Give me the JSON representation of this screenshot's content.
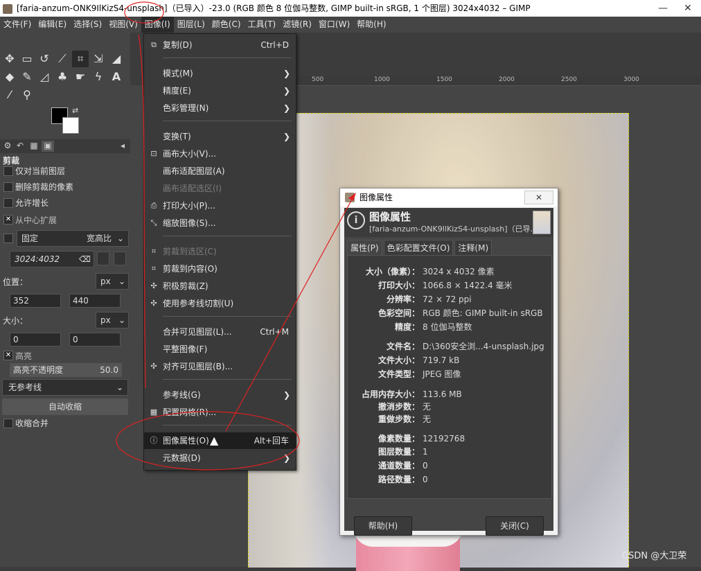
{
  "window": {
    "title": "[faria-anzum-ONK9IlKizS4-unsplash]（已导入）-23.0 (RGB 颜色 8 位伽马整数, GIMP built-in sRGB, 1 个图层) 3024x4032 – GIMP",
    "minimize": "—",
    "close": "✕"
  },
  "menubar": [
    "文件(F)",
    "编辑(E)",
    "选择(S)",
    "视图(V)",
    "图像(I)",
    "图层(L)",
    "颜色(C)",
    "工具(T)",
    "滤镜(R)",
    "窗口(W)",
    "帮助(H)"
  ],
  "toolbox": {
    "section_title": "剪裁",
    "opt_current_layer": "仅对当前图层",
    "opt_delete_pixels": "删除剪裁的像素",
    "opt_allow_grow": "允许增长",
    "opt_expand_center": "从中心扩展",
    "fixed_label": "固定",
    "fixed_value": "宽高比",
    "ratio_value": "3024:4032",
    "position_label": "位置：",
    "position_unit": "px",
    "pos_x": "352",
    "pos_y": "440",
    "size_label": "大小：",
    "size_unit": "px",
    "size_w": "0",
    "size_h": "0",
    "highlight_label": "高亮",
    "highlight_opacity_label": "高亮不透明度",
    "highlight_opacity_value": "50.0",
    "guides_value": "无参考线",
    "auto_shrink": "自动收缩",
    "shrink_merged": "收缩合并"
  },
  "ruler": [
    "500",
    "1000",
    "1500",
    "2000",
    "2500",
    "3000"
  ],
  "image_menu": {
    "items": [
      {
        "label": "复制(D)",
        "shortcut": "Ctrl+D",
        "icon": "duplicate-icon"
      },
      {
        "label": "模式(M)",
        "submenu": true
      },
      {
        "label": "精度(E)",
        "submenu": true
      },
      {
        "label": "色彩管理(N)",
        "submenu": true
      },
      {
        "label": "变换(T)",
        "submenu": true
      },
      {
        "label": "画布大小(V)...",
        "icon": "canvas-size-icon"
      },
      {
        "label": "画布适配图层(A)"
      },
      {
        "label": "画布适配选区(I)",
        "disabled": true
      },
      {
        "label": "打印大小(P)...",
        "icon": "print-size-icon"
      },
      {
        "label": "缩放图像(S)...",
        "icon": "scale-image-icon"
      },
      {
        "label": "剪裁到选区(C)",
        "disabled": true,
        "icon": "crop-selection-icon"
      },
      {
        "label": "剪裁到内容(O)",
        "icon": "crop-content-icon"
      },
      {
        "label": "积极剪裁(Z)",
        "icon": "zealous-crop-icon"
      },
      {
        "label": "使用参考线切割(U)",
        "icon": "guillotine-icon"
      },
      {
        "label": "合并可见图层(L)...",
        "shortcut": "Ctrl+M"
      },
      {
        "label": "平整图像(F)"
      },
      {
        "label": "对齐可见图层(B)...",
        "icon": "align-layers-icon"
      },
      {
        "label": "参考线(G)",
        "submenu": true
      },
      {
        "label": "配置网格(R)...",
        "icon": "grid-icon"
      },
      {
        "label": "图像属性(O)",
        "shortcut": "Alt+回车",
        "icon": "info-icon",
        "highlighted": true
      },
      {
        "label": "元数据(D)",
        "submenu": true
      }
    ]
  },
  "dialog": {
    "title": "图像属性",
    "close": "✕",
    "header_title": "图像属性",
    "header_sub": "[faria-anzum-ONK9IlKizS4-unsplash]（已导...",
    "tabs": [
      "属性(P)",
      "色彩配置文件(O)",
      "注释(M)"
    ],
    "rows": [
      {
        "k": "大小（像素）：",
        "v": "3024 x 4032 像素"
      },
      {
        "k": "打印大小：",
        "v": "1066.8 × 1422.4 毫米"
      },
      {
        "k": "分辨率：",
        "v": "72 ×  72 ppi"
      },
      {
        "k": "色彩空间：",
        "v": "RGB 颜色: GIMP built-in sRGB"
      },
      {
        "k": "精度：",
        "v": "8 位伽马整数"
      },
      {
        "k": "文件名：",
        "v": "D:\\360安全浏...4-unsplash.jpg"
      },
      {
        "k": "文件大小：",
        "v": "719.7 kB"
      },
      {
        "k": "文件类型：",
        "v": "JPEG 图像"
      },
      {
        "k": "占用内存大小：",
        "v": "113.6 MB"
      },
      {
        "k": "撤消步数：",
        "v": "无"
      },
      {
        "k": "重做步数：",
        "v": "无"
      },
      {
        "k": "像素数量：",
        "v": "12192768"
      },
      {
        "k": "图层数量：",
        "v": "1"
      },
      {
        "k": "通道数量：",
        "v": "0"
      },
      {
        "k": "路径数量：",
        "v": "0"
      }
    ],
    "help_button": "帮助(H)",
    "close_button": "关闭(C)"
  },
  "watermark": "CSDN @大卫荣",
  "colors": {
    "annotation_red": "#e02020",
    "selection_dash": "#d7d000"
  }
}
